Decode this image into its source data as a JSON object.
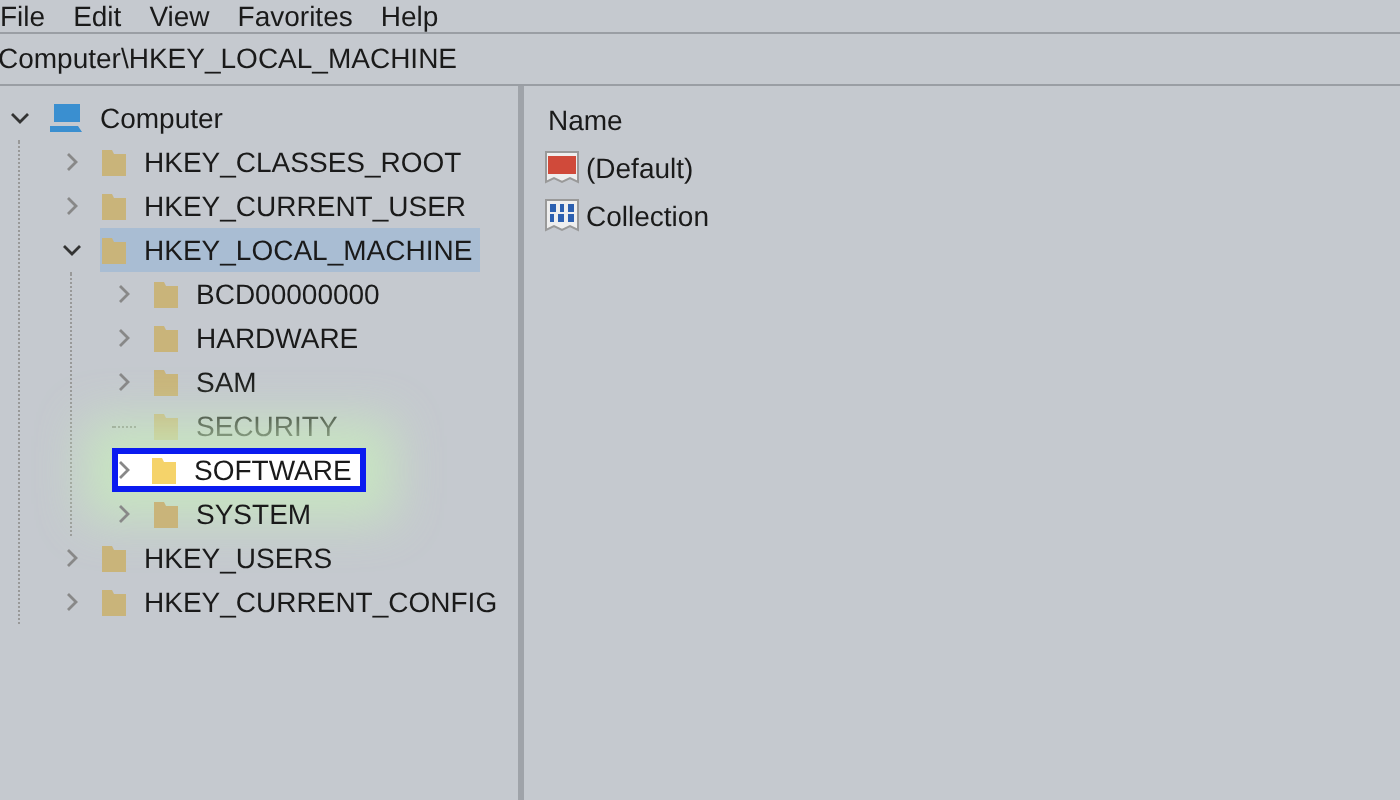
{
  "menu": [
    "File",
    "Edit",
    "View",
    "Favorites",
    "Help"
  ],
  "address": "Computer\\HKEY_LOCAL_MACHINE",
  "tree": [
    {
      "label": "Computer",
      "kind": "computer",
      "expanded": true,
      "selected": false,
      "highlighted": false,
      "children": [
        {
          "label": "HKEY_CLASSES_ROOT",
          "kind": "folder",
          "expanded": false,
          "selected": false,
          "highlighted": false
        },
        {
          "label": "HKEY_CURRENT_USER",
          "kind": "folder",
          "expanded": false,
          "selected": false,
          "highlighted": false
        },
        {
          "label": "HKEY_LOCAL_MACHINE",
          "kind": "folder",
          "expanded": true,
          "selected": true,
          "highlighted": false,
          "children": [
            {
              "label": "BCD00000000",
              "kind": "folder",
              "expanded": false,
              "selected": false,
              "highlighted": false
            },
            {
              "label": "HARDWARE",
              "kind": "folder",
              "expanded": false,
              "selected": false,
              "highlighted": false
            },
            {
              "label": "SAM",
              "kind": "folder",
              "expanded": false,
              "selected": false,
              "highlighted": false
            },
            {
              "label": "SECURITY",
              "kind": "leaf",
              "selected": false,
              "highlighted": false
            },
            {
              "label": "SOFTWARE",
              "kind": "folder",
              "expanded": false,
              "selected": false,
              "highlighted": true
            },
            {
              "label": "SYSTEM",
              "kind": "folder",
              "expanded": false,
              "selected": false,
              "highlighted": false
            }
          ]
        },
        {
          "label": "HKEY_USERS",
          "kind": "folder",
          "expanded": false,
          "selected": false,
          "highlighted": false
        },
        {
          "label": "HKEY_CURRENT_CONFIG",
          "kind": "folder",
          "expanded": false,
          "selected": false,
          "highlighted": false
        }
      ]
    }
  ],
  "values": {
    "column": "Name",
    "rows": [
      {
        "name": "(Default)",
        "kind": "string"
      },
      {
        "name": "Collection",
        "kind": "binary"
      }
    ]
  }
}
